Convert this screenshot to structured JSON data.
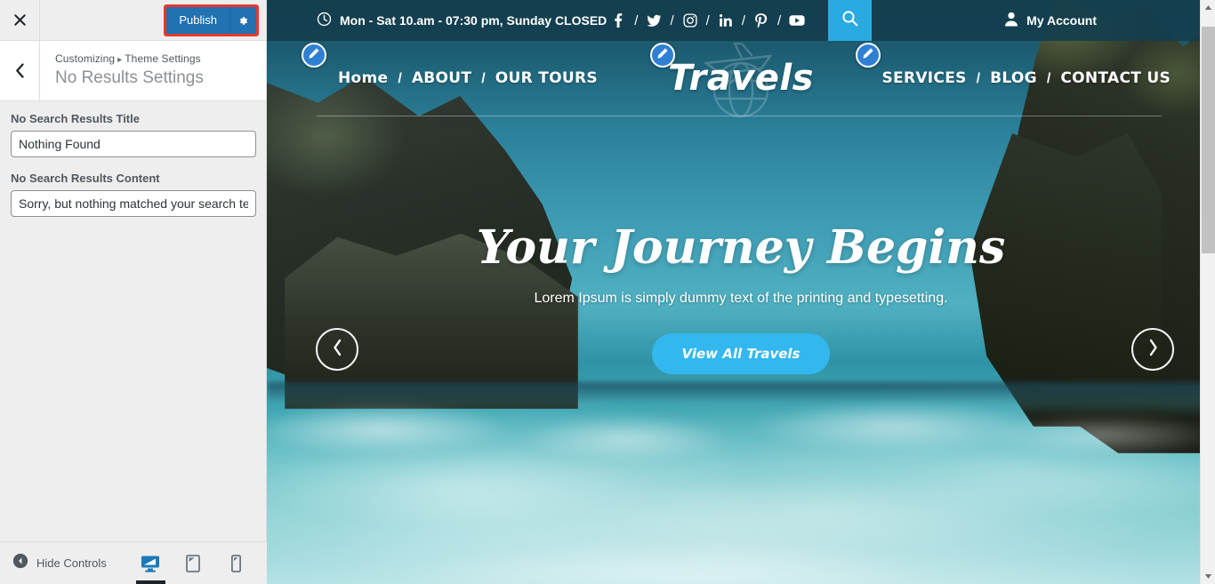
{
  "customizer": {
    "close_icon": "close-icon",
    "back_icon": "chevron-left-icon",
    "publish_label": "Publish",
    "gear_icon": "gear-icon",
    "breadcrumb_root": "Customizing",
    "breadcrumb_sep": "▸",
    "breadcrumb_section": "Theme Settings",
    "panel_title": "No Results Settings",
    "fields": [
      {
        "label": "No Search Results Title",
        "value": "Nothing Found",
        "name": "no-search-results-title-input"
      },
      {
        "label": "No Search Results Content",
        "value": "Sorry, but nothing matched your search terms.",
        "name": "no-search-results-content-input"
      }
    ],
    "footer": {
      "hide_controls_label": "Hide Controls",
      "collapse_icon": "collapse-left-icon",
      "devices": [
        {
          "name": "device-desktop",
          "icon": "desktop-icon",
          "active": true
        },
        {
          "name": "device-tablet",
          "icon": "tablet-icon",
          "active": false
        },
        {
          "name": "device-mobile",
          "icon": "mobile-icon",
          "active": false
        }
      ]
    },
    "colors": {
      "publish_blue": "#2271b1",
      "highlight_red": "#e8372c",
      "panel_bg": "#eeeeee"
    }
  },
  "preview": {
    "topbar": {
      "clock_icon": "clock-icon",
      "hours_text": "Mon - Sat 10.am - 07:30 pm, Sunday CLOSED",
      "socials": [
        {
          "name": "facebook-icon",
          "label": "f"
        },
        {
          "name": "twitter-icon",
          "label": "t"
        },
        {
          "name": "instagram-icon",
          "label": "ig"
        },
        {
          "name": "linkedin-icon",
          "label": "in"
        },
        {
          "name": "pinterest-icon",
          "label": "p"
        },
        {
          "name": "youtube-icon",
          "label": "yt"
        }
      ],
      "social_separator": "/",
      "search_icon": "search-icon",
      "account_icon": "user-icon",
      "account_label": "My Account",
      "search_bg": "#29abe2",
      "bar_bg": "#143e4e"
    },
    "nav": {
      "left_links": [
        "Home",
        "ABOUT",
        "OUR TOURS"
      ],
      "right_links": [
        "SERVICES",
        "BLOG",
        "CONTACT US"
      ],
      "separator": "/",
      "brand": "Travels",
      "brand_watermark_icon": "airplane-globe-icon",
      "edit_icon": "pencil-edit-icon"
    },
    "hero": {
      "title": "Your Journey Begins",
      "subtitle": "Lorem Ipsum is simply dummy text of the printing and typesetting.",
      "button_label": "View All Travels",
      "button_bg": "#32b7ee",
      "prev_icon": "chevron-left-icon",
      "next_icon": "chevron-right-icon"
    }
  },
  "scrollbar": {
    "up_icon": "scroll-up-icon",
    "down_icon": "scroll-down-icon",
    "thumb": "scroll-thumb"
  }
}
